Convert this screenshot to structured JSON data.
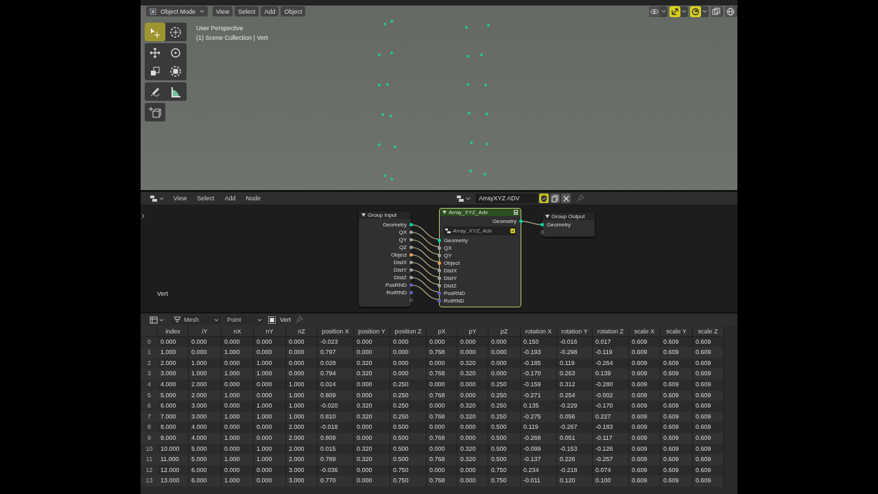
{
  "viewport": {
    "header": {
      "mode": "Object Mode",
      "menus": [
        "View",
        "Select",
        "Add",
        "Object"
      ],
      "toggles": [
        {
          "kind": "visibility",
          "on": false
        },
        {
          "kind": "gizmo",
          "on": true
        },
        {
          "kind": "overlay",
          "on": true
        },
        {
          "kind": "xray",
          "on": false
        },
        {
          "kind": "shading",
          "on": false
        }
      ]
    },
    "info": [
      "User Perspective",
      "(1) Scene Collection | Vert"
    ],
    "tool_groups": [
      [
        {
          "kind": "select",
          "selected": true
        },
        {
          "kind": "cursor",
          "selected": false
        }
      ],
      [
        {
          "kind": "move",
          "selected": false
        },
        {
          "kind": "rotate",
          "selected": false
        },
        {
          "kind": "scale",
          "selected": false
        },
        {
          "kind": "transform",
          "selected": false
        }
      ],
      [
        {
          "kind": "annotate",
          "selected": false
        },
        {
          "kind": "measure",
          "selected": false
        }
      ],
      [
        {
          "kind": "add-cube",
          "selected": false
        }
      ]
    ]
  },
  "node_editor": {
    "header": {
      "menus": [
        "View",
        "Select",
        "Add",
        "Node"
      ],
      "tree_name": "ArrayXYZ ADV",
      "fake_user": true
    },
    "object_label": "Vert",
    "group_input": {
      "title": "Group Input",
      "outputs": [
        {
          "name": "Geometry",
          "color": "#00d6a3"
        },
        {
          "name": "QX",
          "color": "#a1a1a1"
        },
        {
          "name": "QY",
          "color": "#a1a1a1"
        },
        {
          "name": "QZ",
          "color": "#a1a1a1"
        },
        {
          "name": "Object",
          "color": "#ed9e5c"
        },
        {
          "name": "DistX",
          "color": "#a1a1a1"
        },
        {
          "name": "DistY",
          "color": "#a1a1a1"
        },
        {
          "name": "DistZ",
          "color": "#a1a1a1"
        },
        {
          "name": "PosRND",
          "color": "#6363c7"
        },
        {
          "name": "RotRND",
          "color": "#6363c7"
        }
      ]
    },
    "group_node": {
      "title": "Array_XYZ_Adv",
      "tree": "Array_XYZ_Adv",
      "outputs": [
        {
          "name": "Geometry",
          "color": "#00d6a3"
        }
      ],
      "inputs": [
        {
          "name": "Geometry",
          "color": "#00d6a3"
        },
        {
          "name": "QX",
          "color": "#a1a1a1"
        },
        {
          "name": "QY",
          "color": "#a1a1a1"
        },
        {
          "name": "Object",
          "color": "#ed9e5c"
        },
        {
          "name": "DistX",
          "color": "#a1a1a1"
        },
        {
          "name": "DistY",
          "color": "#a1a1a1"
        },
        {
          "name": "DistZ",
          "color": "#a1a1a1"
        },
        {
          "name": "PosRND",
          "color": "#6363c7"
        },
        {
          "name": "RotRND",
          "color": "#6363c7"
        }
      ]
    },
    "group_output": {
      "title": "Group Output",
      "inputs": [
        {
          "name": "Geometry",
          "color": "#00d6a3"
        }
      ]
    }
  },
  "spreadsheet": {
    "header": {
      "domain": "Mesh",
      "element": "Point",
      "object": "Vert"
    },
    "columns": [
      "index",
      "iY",
      "nX",
      "nY",
      "nZ",
      "position X",
      "position Y",
      "position Z",
      "pX",
      "pY",
      "pZ",
      "rotation X",
      "rotation Y",
      "rotation Z",
      "scale X",
      "scale Y",
      "scale Z"
    ],
    "rows": [
      {
        "n": "0",
        "cells": [
          "0.000",
          "0.000",
          "0.000",
          "0.000",
          "0.000",
          "-0.023",
          "0.000",
          "0.000",
          "0.000",
          "0.000",
          "0.000",
          "0.150",
          "-0.016",
          "0.017",
          "0.609",
          "0.609",
          "0.609"
        ]
      },
      {
        "n": "1",
        "cells": [
          "1.000",
          "0.000",
          "1.000",
          "0.000",
          "0.000",
          "0.797",
          "0.000",
          "0.000",
          "0.768",
          "0.000",
          "0.000",
          "-0.193",
          "-0.298",
          "-0.119",
          "0.609",
          "0.609",
          "0.609"
        ]
      },
      {
        "n": "2",
        "cells": [
          "2.000",
          "1.000",
          "0.000",
          "1.000",
          "0.000",
          "0.028",
          "0.320",
          "0.000",
          "0.000",
          "0.320",
          "0.000",
          "-0.185",
          "0.119",
          "-0.264",
          "0.609",
          "0.609",
          "0.609"
        ]
      },
      {
        "n": "3",
        "cells": [
          "3.000",
          "1.000",
          "1.000",
          "1.000",
          "0.000",
          "0.794",
          "0.320",
          "0.000",
          "0.768",
          "0.320",
          "0.000",
          "-0.170",
          "0.263",
          "0.139",
          "0.609",
          "0.609",
          "0.609"
        ]
      },
      {
        "n": "4",
        "cells": [
          "4.000",
          "2.000",
          "0.000",
          "0.000",
          "1.000",
          "0.024",
          "0.000",
          "0.250",
          "0.000",
          "0.000",
          "0.250",
          "-0.159",
          "0.312",
          "-0.280",
          "0.609",
          "0.609",
          "0.609"
        ]
      },
      {
        "n": "5",
        "cells": [
          "5.000",
          "2.000",
          "1.000",
          "0.000",
          "1.000",
          "0.809",
          "0.000",
          "0.250",
          "0.768",
          "0.000",
          "0.250",
          "-0.271",
          "0.254",
          "-0.002",
          "0.609",
          "0.609",
          "0.609"
        ]
      },
      {
        "n": "6",
        "cells": [
          "6.000",
          "3.000",
          "0.000",
          "1.000",
          "1.000",
          "-0.020",
          "0.320",
          "0.250",
          "0.000",
          "0.320",
          "0.250",
          "0.135",
          "-0.229",
          "-0.170",
          "0.609",
          "0.609",
          "0.609"
        ]
      },
      {
        "n": "7",
        "cells": [
          "7.000",
          "3.000",
          "1.000",
          "1.000",
          "1.000",
          "0.810",
          "0.320",
          "0.250",
          "0.768",
          "0.320",
          "0.250",
          "-0.275",
          "0.056",
          "0.227",
          "0.609",
          "0.609",
          "0.609"
        ]
      },
      {
        "n": "8",
        "cells": [
          "8.000",
          "4.000",
          "0.000",
          "0.000",
          "2.000",
          "-0.018",
          "0.000",
          "0.500",
          "0.000",
          "0.000",
          "0.500",
          "0.119",
          "-0.267",
          "-0.183",
          "0.609",
          "0.609",
          "0.609"
        ]
      },
      {
        "n": "9",
        "cells": [
          "9.000",
          "4.000",
          "1.000",
          "0.000",
          "2.000",
          "0.809",
          "0.000",
          "0.500",
          "0.768",
          "0.000",
          "0.500",
          "-0.268",
          "0.051",
          "-0.117",
          "0.609",
          "0.609",
          "0.609"
        ]
      },
      {
        "n": "10",
        "cells": [
          "10.000",
          "5.000",
          "0.000",
          "1.000",
          "2.000",
          "0.015",
          "0.320",
          "0.500",
          "0.000",
          "0.320",
          "0.500",
          "-0.099",
          "-0.153",
          "-0.126",
          "0.609",
          "0.609",
          "0.609"
        ]
      },
      {
        "n": "11",
        "cells": [
          "11.000",
          "5.000",
          "1.000",
          "1.000",
          "2.000",
          "0.789",
          "0.320",
          "0.500",
          "0.768",
          "0.320",
          "0.500",
          "-0.137",
          "0.226",
          "-0.257",
          "0.609",
          "0.609",
          "0.609"
        ]
      },
      {
        "n": "12",
        "cells": [
          "12.000",
          "6.000",
          "0.000",
          "0.000",
          "3.000",
          "-0.036",
          "0.000",
          "0.750",
          "0.000",
          "0.000",
          "0.750",
          "0.234",
          "-0.218",
          "0.074",
          "0.609",
          "0.609",
          "0.609"
        ]
      },
      {
        "n": "13",
        "cells": [
          "13.000",
          "6.000",
          "1.000",
          "0.000",
          "3.000",
          "0.770",
          "0.000",
          "0.750",
          "0.768",
          "0.000",
          "0.750",
          "-0.011",
          "0.120",
          "0.100",
          "0.609",
          "0.609",
          "0.609"
        ]
      }
    ]
  }
}
